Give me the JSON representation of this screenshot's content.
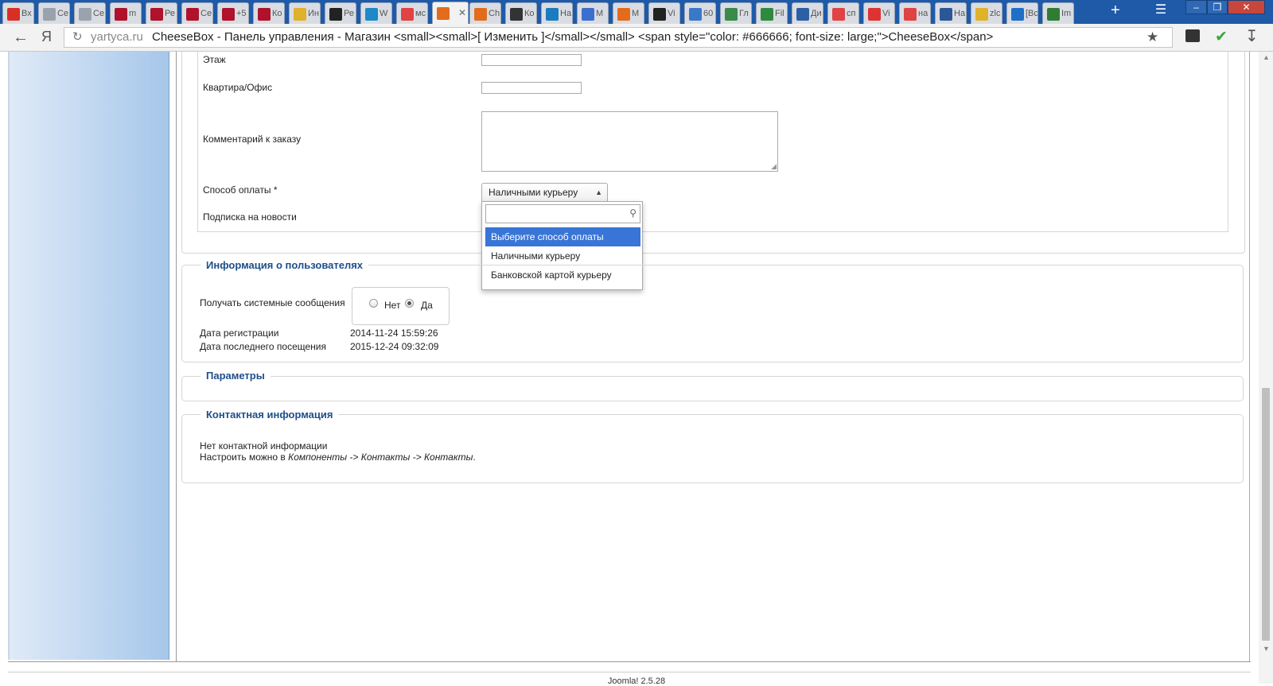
{
  "browser": {
    "tabs": [
      {
        "label": "Вх",
        "icon": "gmail-icon",
        "color": "#d93025"
      },
      {
        "label": "Се",
        "icon": "h-site-icon",
        "color": "#9aa3ad"
      },
      {
        "label": "Се",
        "icon": "h-site-icon",
        "color": "#9aa3ad"
      },
      {
        "label": "m",
        "icon": "redmine-icon",
        "color": "#b0122b"
      },
      {
        "label": "Ре",
        "icon": "redmine-icon",
        "color": "#b0122b"
      },
      {
        "label": "Се",
        "icon": "redmine-icon",
        "color": "#b0122b"
      },
      {
        "label": "+5",
        "icon": "redmine-icon",
        "color": "#b0122b"
      },
      {
        "label": "Ко",
        "icon": "redmine-icon",
        "color": "#b0122b"
      },
      {
        "label": "Ин",
        "icon": "smiley-icon",
        "color": "#e0b12a"
      },
      {
        "label": "Ре",
        "icon": "arrow-icon",
        "color": "#222222"
      },
      {
        "label": "W",
        "icon": "check-icon",
        "color": "#1e88c8"
      },
      {
        "label": "мс",
        "icon": "yandex-icon",
        "color": "#e04343"
      },
      {
        "label": "",
        "icon": "joomla-icon",
        "color": "#e36c1c",
        "active": true
      },
      {
        "label": "Ch",
        "icon": "joomla-icon",
        "color": "#e36c1c"
      },
      {
        "label": "Ко",
        "icon": "back-arrow-icon",
        "color": "#333333"
      },
      {
        "label": "На",
        "icon": "vm-icon",
        "color": "#1b7bbf"
      },
      {
        "label": "M",
        "icon": "d-icon",
        "color": "#3b6fcf"
      },
      {
        "label": "M",
        "icon": "joomla-icon",
        "color": "#e36c1c"
      },
      {
        "label": "Vi",
        "icon": "x-icon",
        "color": "#222222"
      },
      {
        "label": "60",
        "icon": "mail-icon",
        "color": "#3a78c9"
      },
      {
        "label": "Гл",
        "icon": "eye-icon",
        "color": "#3a8a4a"
      },
      {
        "label": "Fil",
        "icon": "g-icon",
        "color": "#2e8b3e"
      },
      {
        "label": "Ди",
        "icon": "play-icon",
        "color": "#2d5fa4"
      },
      {
        "label": "сп",
        "icon": "yandex-icon",
        "color": "#e04343"
      },
      {
        "label": "Vi",
        "icon": "pin-icon",
        "color": "#d33"
      },
      {
        "label": "на",
        "icon": "yandex-icon",
        "color": "#e04343"
      },
      {
        "label": "На",
        "icon": "word-icon",
        "color": "#2b5797"
      },
      {
        "label": "zlc",
        "icon": "smiley-icon",
        "color": "#e0b12a"
      },
      {
        "label": "[Вс",
        "icon": "l-icon",
        "color": "#1e6fc8"
      },
      {
        "label": "Im",
        "icon": "dot-icon",
        "color": "#2e7d32"
      }
    ],
    "new_tab": "+",
    "url_domain": "yartyca.ru",
    "url_title": "CheeseBox - Панель управления - Магазин <small><small>[ Изменить ]</small></small>  <span style=\"color: #666666; font-size: large;\">CheeseBox</span>"
  },
  "form": {
    "floor_label": "Этаж",
    "apartment_label": "Квартира/Офис",
    "comment_label": "Комментарий к заказу",
    "payment_label": "Способ оплаты *",
    "payment_selected": "Наличными курьеру",
    "newsletter_label": "Подписка на новости",
    "dropdown_options": [
      "Выберите способ оплаты",
      "Наличными курьеру",
      "Банковской картой курьеру"
    ]
  },
  "user_info": {
    "legend": "Информация о пользователях",
    "system_messages_label": "Получать системные сообщения",
    "no_label": "Нет",
    "yes_label": "Да",
    "selected": "yes",
    "reg_date_label": "Дата регистрации",
    "reg_date": "2014-11-24 15:59:26",
    "last_visit_label": "Дата последнего посещения",
    "last_visit": "2015-12-24 09:32:09"
  },
  "params": {
    "legend": "Параметры"
  },
  "contact": {
    "legend": "Контактная информация",
    "line1": "Нет контактной информации",
    "line2_prefix": "Настроить можно в ",
    "line2_path": "Компоненты -> Контакты -> Контакты",
    "line2_suffix": "."
  },
  "footer": {
    "version": "Joomla! 2.5.28"
  }
}
